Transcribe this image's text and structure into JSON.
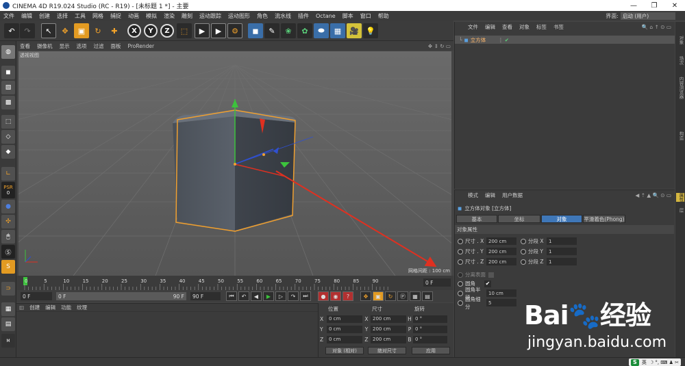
{
  "window": {
    "title": "CINEMA 4D R19.024 Studio (RC - R19) - [未标题 1 *] - 主要",
    "controls": [
      "—",
      "❐",
      "✕"
    ]
  },
  "menubar": {
    "items": [
      "文件",
      "编辑",
      "创建",
      "选择",
      "工具",
      "网格",
      "捕捉",
      "动画",
      "模拟",
      "渲染",
      "雕刻",
      "运动跟踪",
      "运动图形",
      "角色",
      "流水线",
      "插件",
      "Octane",
      "脚本",
      "窗口",
      "帮助"
    ],
    "layout_label": "界面:",
    "layout_value": "启动 (用户)"
  },
  "toolbar": {
    "axis_labels": [
      "X",
      "Y",
      "Z"
    ]
  },
  "left_tools": {
    "psr_label": "PSR",
    "psr_value": "0"
  },
  "viewport": {
    "menu": [
      "查看",
      "摄像机",
      "显示",
      "选项",
      "过滤",
      "面板",
      "ProRender"
    ],
    "label": "透视视图",
    "grid_info": "网格间距 : 100 cm"
  },
  "timeline": {
    "ticks": [
      "0",
      "5",
      "10",
      "15",
      "20",
      "25",
      "30",
      "35",
      "40",
      "45",
      "50",
      "55",
      "60",
      "65",
      "70",
      "75",
      "80",
      "85",
      "90"
    ],
    "current_frame": "0 F"
  },
  "transport": {
    "start": "0 F",
    "range_start": "0 F",
    "range_end": "90 F",
    "end": "90 F"
  },
  "material_panel": {
    "menu": [
      "创建",
      "编辑",
      "功能",
      "纹理"
    ]
  },
  "coords": {
    "headers": [
      "位置",
      "尺寸",
      "旋转"
    ],
    "rows": [
      {
        "a": "X",
        "pos": "0 cm",
        "size": "200 cm",
        "r": "H",
        "rot": "0 °"
      },
      {
        "a": "Y",
        "pos": "0 cm",
        "size": "200 cm",
        "r": "P",
        "rot": "0 °"
      },
      {
        "a": "Z",
        "pos": "0 cm",
        "size": "200 cm",
        "r": "B",
        "rot": "0 °"
      }
    ],
    "mode_left": "对象 (相对)",
    "mode_right": "绝对尺寸",
    "apply": "应用"
  },
  "object_manager": {
    "menu": [
      "文件",
      "编辑",
      "查看",
      "对象",
      "标签",
      "书签"
    ],
    "object_name": "立方体"
  },
  "attributes": {
    "menu": [
      "模式",
      "编辑",
      "用户数据"
    ],
    "object_title": "立方体对象 [立方体]",
    "tabs": [
      "基本",
      "坐标",
      "对象",
      "平滑着色(Phong)"
    ],
    "section": "对象属性",
    "size_rows": [
      {
        "label": "尺寸 . X",
        "value": "200 cm",
        "seg_label": "分段 X",
        "seg": "1"
      },
      {
        "label": "尺寸 . Y",
        "value": "200 cm",
        "seg_label": "分段 Y",
        "seg": "1"
      },
      {
        "label": "尺寸 . Z",
        "value": "200 cm",
        "seg_label": "分段 Z",
        "seg": "1"
      }
    ],
    "separate_surfaces": "分离表面",
    "fillet": "圆角",
    "fillet_check": "✔",
    "fillet_radius_label": "圆角半径",
    "fillet_radius": "10 cm",
    "fillet_subdiv_label": "圆角细分",
    "fillet_subdiv": "5"
  },
  "right_tabs": [
    "对象",
    "场次",
    "内容浏览器",
    "构造",
    "属性",
    "层"
  ],
  "watermark": {
    "logo": "Bai🐾经验",
    "url": "jingyan.baidu.com"
  },
  "ime": {
    "logo": "S",
    "lang": "英",
    "icons": "☽ °, ⌨ ♟ ✂"
  },
  "colors": {
    "accent_blue": "#3f77b8",
    "selection_orange": "#f0a030",
    "arrow_red": "#e03020"
  }
}
